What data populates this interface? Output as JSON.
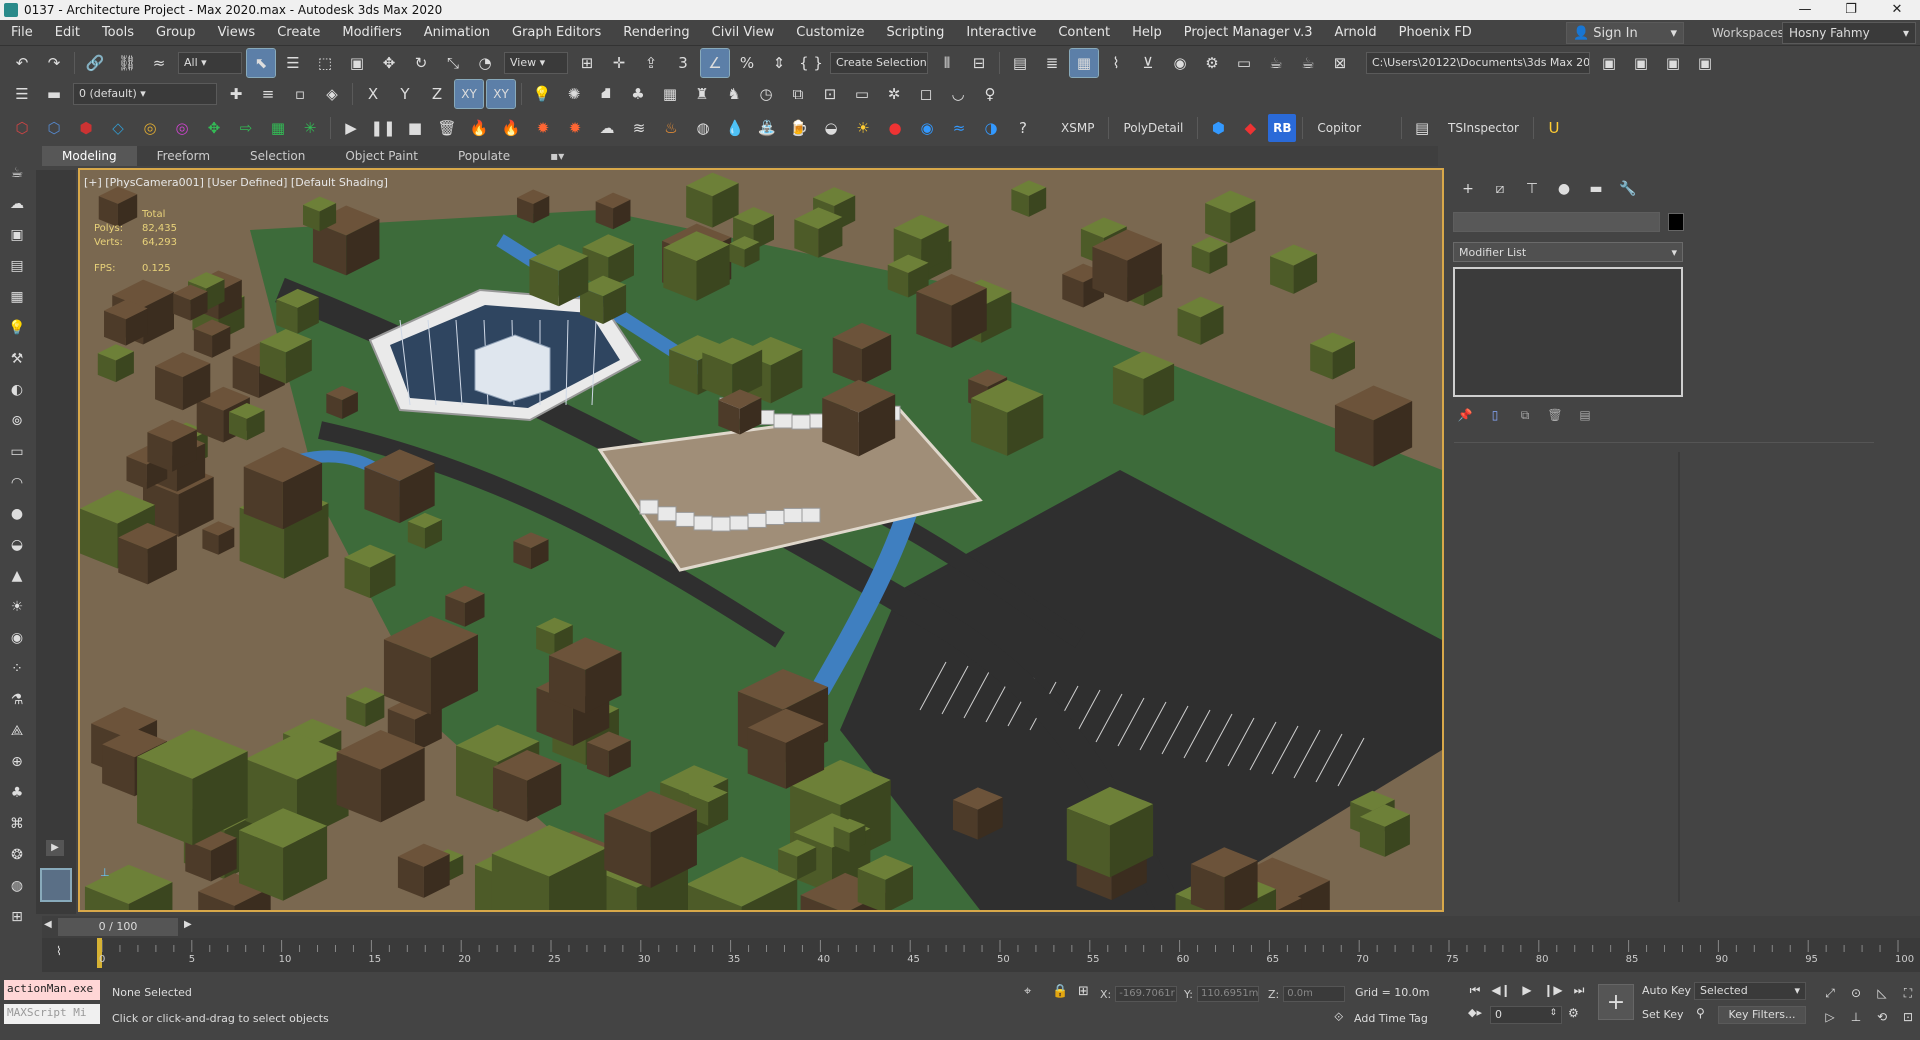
{
  "window": {
    "title": "0137 - Architecture Project - Max 2020.max - Autodesk 3ds Max 2020",
    "controls": [
      "minimize-icon",
      "maximize-icon",
      "close-icon"
    ]
  },
  "menubar": {
    "items": [
      "File",
      "Edit",
      "Tools",
      "Group",
      "Views",
      "Create",
      "Modifiers",
      "Animation",
      "Graph Editors",
      "Rendering",
      "Civil View",
      "Customize",
      "Scripting",
      "Interactive",
      "Content",
      "Help",
      "Project Manager v.3",
      "Arnold",
      "Phoenix FD"
    ],
    "sign_in": "Sign In",
    "workspaces_label": "Workspaces:",
    "workspace_value": "Hosny Fahmy"
  },
  "toolbar1": {
    "selection_filter": "All",
    "ref_coord": "View",
    "named_selection": "Create Selection Se",
    "project_path": "C:\\Users\\20122\\Documents\\3ds Max 2020",
    "axis_xy": "XY",
    "axis_xy2": "XY"
  },
  "toolbar2": {
    "layer": "0 (default)",
    "axes": [
      "X",
      "Y",
      "Z",
      "XY",
      "XY"
    ]
  },
  "toolbar3": {
    "labels": [
      "XSMP",
      "PolyDetail",
      "RB",
      "Copitor",
      "TSInspector"
    ]
  },
  "ribbon": {
    "tabs": [
      "Modeling",
      "Freeform",
      "Selection",
      "Object Paint",
      "Populate"
    ],
    "active": "Modeling"
  },
  "viewport": {
    "label": "[+] [PhysCamera001] [User Defined] [Default Shading]",
    "stats": {
      "header": "Total",
      "polys_label": "Polys:",
      "polys": "82,435",
      "verts_label": "Verts:",
      "verts": "64,293",
      "fps_label": "FPS:",
      "fps": "0.125"
    }
  },
  "command_panel": {
    "modifier_list": "Modifier List"
  },
  "timeline": {
    "frame_counter": "0 / 100",
    "tick_labels": [
      "0",
      "5",
      "10",
      "15",
      "20",
      "25",
      "30",
      "35",
      "40",
      "45",
      "50",
      "55",
      "60",
      "65",
      "70",
      "75",
      "80",
      "85",
      "90",
      "95",
      "100"
    ]
  },
  "statusbar": {
    "script_line1": "actionMan.exe",
    "script_line2": "MAXScript Mi",
    "selection_status": "None Selected",
    "prompt": "Click or click-and-drag to select objects",
    "x_label": "X:",
    "x_value": "-169.7061r",
    "y_label": "Y:",
    "y_value": "110.6951m",
    "z_label": "Z:",
    "z_value": "0.0m",
    "grid": "Grid = 10.0m",
    "add_time_tag": "Add Time Tag",
    "auto_key": "Auto Key",
    "set_key": "Set Key",
    "selected": "Selected",
    "key_filters": "Key Filters...",
    "frame": "0"
  },
  "colors": {
    "active_viewport_border": "#d8a84a",
    "terrain": "#7a6850",
    "grass": "#3d6b3a",
    "water": "#3f7fc0",
    "road": "#2f2f2f",
    "tree_olive": "#5b6b2f",
    "tree_brown": "#5a4530"
  }
}
